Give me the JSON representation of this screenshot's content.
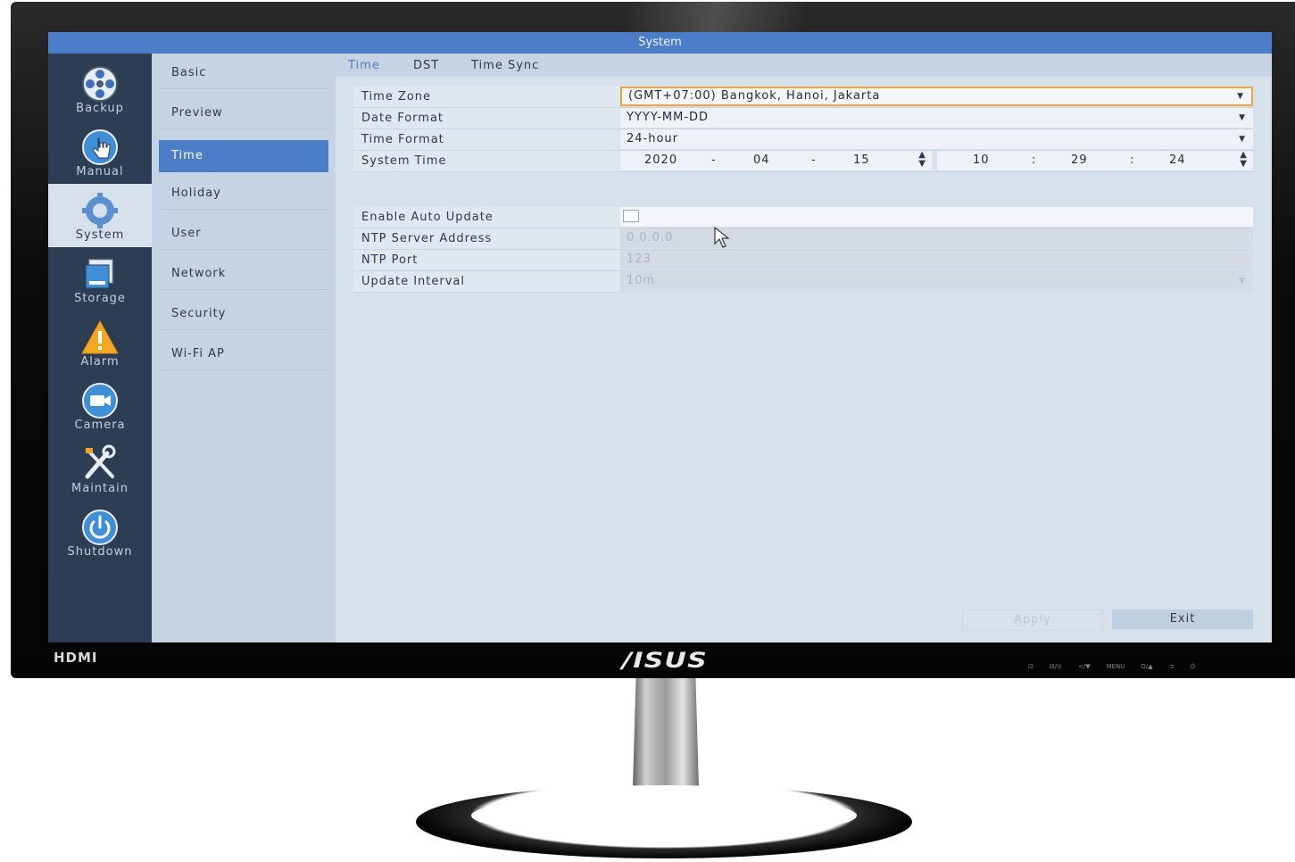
{
  "window": {
    "title": "System"
  },
  "iconbar": {
    "items": [
      {
        "label": "Backup",
        "icon": "film-reel-icon"
      },
      {
        "label": "Manual",
        "icon": "hand-click-icon"
      },
      {
        "label": "System",
        "icon": "gear-icon",
        "active": true
      },
      {
        "label": "Storage",
        "icon": "hard-disk-icon"
      },
      {
        "label": "Alarm",
        "icon": "warning-icon"
      },
      {
        "label": "Camera",
        "icon": "camera-icon"
      },
      {
        "label": "Maintain",
        "icon": "tools-icon"
      },
      {
        "label": "Shutdown",
        "icon": "power-icon"
      }
    ]
  },
  "submenu": {
    "items": [
      {
        "label": "Basic"
      },
      {
        "label": "Preview"
      },
      {
        "label": "Time",
        "active": true
      },
      {
        "label": "Holiday"
      },
      {
        "label": "User"
      },
      {
        "label": "Network"
      },
      {
        "label": "Security"
      },
      {
        "label": "Wi-Fi AP"
      }
    ]
  },
  "tabs": [
    {
      "label": "Time",
      "active": true
    },
    {
      "label": "DST"
    },
    {
      "label": "Time Sync"
    }
  ],
  "time_form": {
    "time_zone": {
      "label": "Time Zone",
      "value": "(GMT+07:00) Bangkok, Hanoi, Jakarta"
    },
    "date_format": {
      "label": "Date Format",
      "value": "YYYY-MM-DD"
    },
    "time_format": {
      "label": "Time Format",
      "value": "24-hour"
    },
    "system_time": {
      "label": "System Time",
      "year": "2020",
      "month": "04",
      "day": "15",
      "date_sep": "-",
      "time_sep": ":",
      "hour": "10",
      "minute": "29",
      "second": "24"
    }
  },
  "sync_form": {
    "auto_update": {
      "label": "Enable Auto Update",
      "checked": false
    },
    "ntp_server": {
      "label": "NTP Server Address",
      "value": "0.0.0.0"
    },
    "ntp_port": {
      "label": "NTP Port",
      "value": "123"
    },
    "update_interval": {
      "label": "Update Interval",
      "value": "10m"
    }
  },
  "buttons": {
    "apply": "Apply",
    "exit": "Exit"
  },
  "monitor": {
    "brand": "/ISUS",
    "port_label": "HDMI",
    "button_labels": [
      "⊡",
      "⊟/⊙",
      "</▼",
      "MENU",
      "O/▲",
      "⊐",
      "⏻"
    ]
  },
  "colors": {
    "titlebar": "#4b7dc8",
    "iconbar": "#2d3d53",
    "accent": "#4b7dc8",
    "focus_border": "#f2a33a"
  }
}
